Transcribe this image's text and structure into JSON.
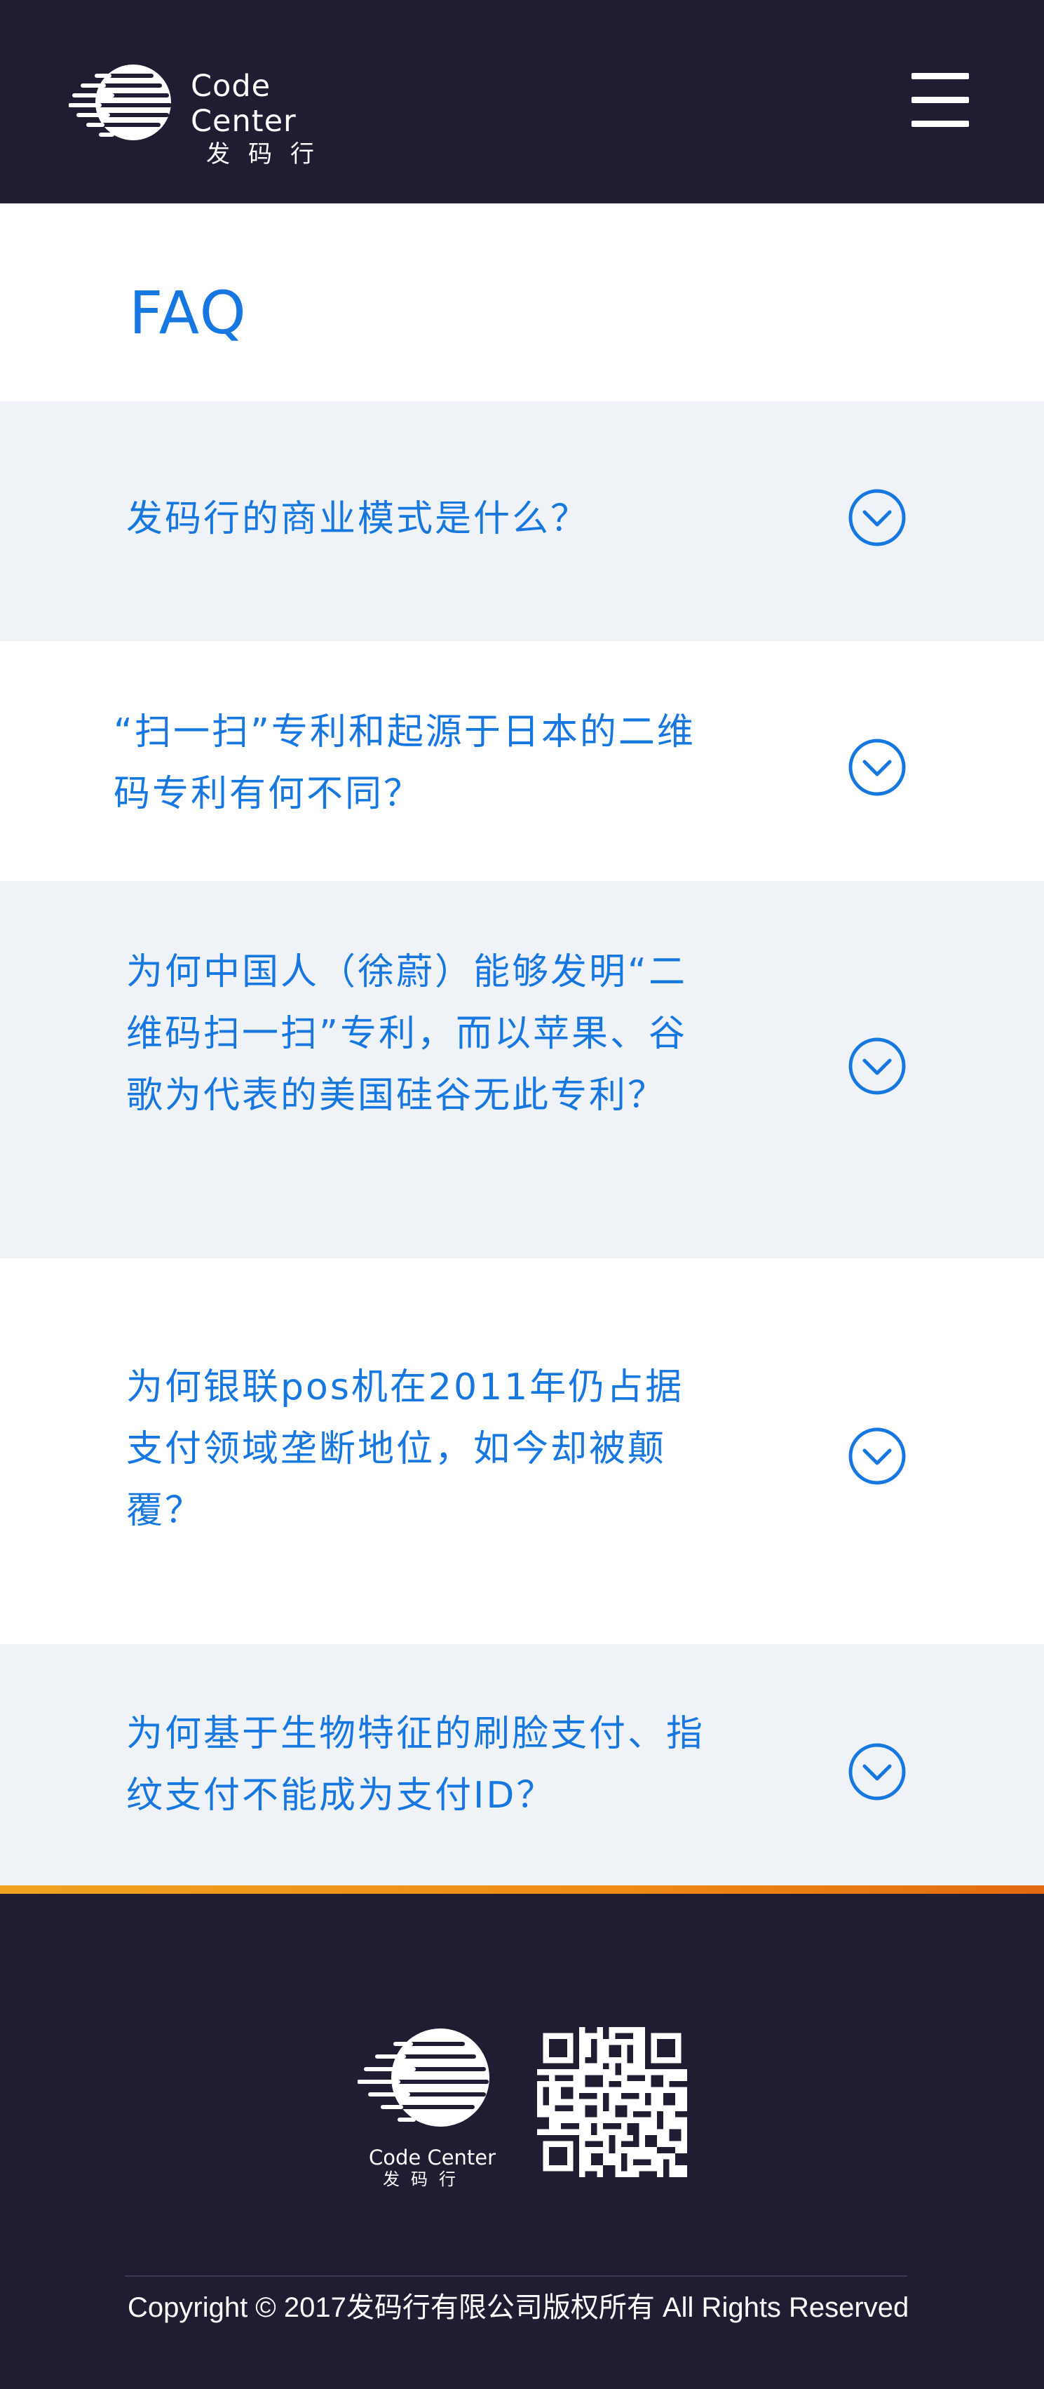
{
  "header": {
    "brand_en": "Code Center",
    "brand_cn": "发码行",
    "menu_icon": "hamburger-menu-icon",
    "background": "#201d33"
  },
  "main": {
    "title": "FAQ",
    "accent": "#1677e0",
    "questions": [
      {
        "text": "发码行的商业模式是什么？",
        "icon": "chevron-down-circle-icon"
      },
      {
        "text": "“扫一扫”专利和起源于日本的二维码专利有何不同？",
        "icon": "chevron-down-circle-icon"
      },
      {
        "text": "为何中国人（徐蔚）能够发明“二维码扫一扫”专利，而以苹果、谷歌为代表的美国硅谷无此专利？",
        "icon": "chevron-down-circle-icon"
      },
      {
        "text": "为何银联pos机在2011年仍占据支付领域垄断地位，如今却被颠覆？",
        "icon": "chevron-down-circle-icon"
      },
      {
        "text": "为何基于生物特征的刷脸支付、指纹支付不能成为支付ID？",
        "icon": "chevron-down-circle-icon"
      }
    ]
  },
  "footer": {
    "brand_en": "Code Center",
    "brand_cn": "发码行",
    "qr_icon": "qr-code-icon",
    "copyright": "Copyright  ©  2017发码行有限公司版权所有 All Rights Reserved",
    "accent_line": "#ef8a14"
  }
}
